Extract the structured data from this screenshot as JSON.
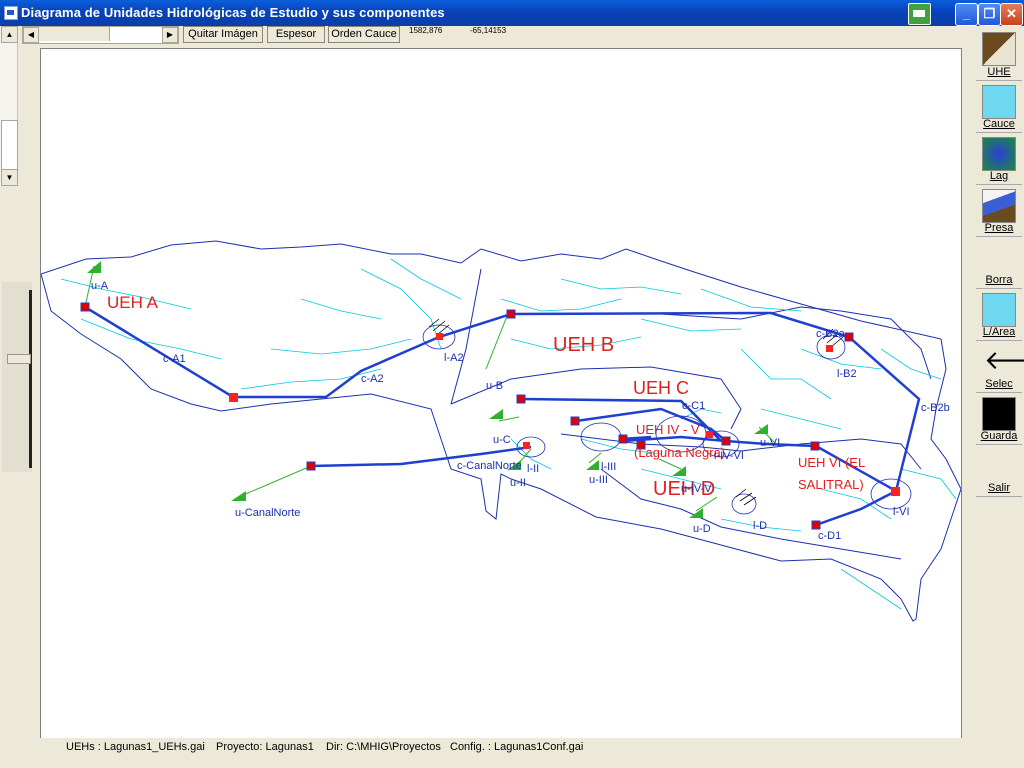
{
  "window": {
    "title": "Diagrama de Unidades Hidrológicas de Estudio y sus componentes"
  },
  "toolbar": {
    "buttons": [
      "Quitar Imágen",
      "Espesor",
      "Orden Cauce"
    ],
    "coord_x": "1582,876",
    "coord_y": "-65,14153"
  },
  "tools": [
    {
      "label": "UHE",
      "icon": "mountain-icon"
    },
    {
      "label": "Cauce",
      "icon": "river-icon"
    },
    {
      "label": "Lag",
      "icon": "lake-icon"
    },
    {
      "label": "Presa",
      "icon": "dam-icon"
    },
    {
      "label": "Borra",
      "icon": ""
    },
    {
      "label": "L/Area",
      "icon": "target-icon"
    },
    {
      "label": "Selec",
      "icon": "arrow-left-icon"
    },
    {
      "label": "Guarda",
      "icon": "floppy-icon"
    },
    {
      "label": "Salir",
      "icon": ""
    }
  ],
  "status": {
    "uehs": "UEHs : Lagunas1_UEHs.gai",
    "project": "Proyecto: Lagunas1",
    "dir": "Dir: C:\\MHIG\\Proyectos",
    "config": "Config. : Lagunas1Conf.gai"
  },
  "map": {
    "regions": [
      "UEH A",
      "UEH B",
      "UEH C",
      "UEH IV - V (Laguna Negra)",
      "UEH D",
      "UEH VI (EL SALITRAL)"
    ],
    "labels": [
      "u-A",
      "c-A1",
      "c-A2",
      "l-A2",
      "u-B",
      "c-B2a",
      "l-B2",
      "c-B2b",
      "c-C1",
      "u-C",
      "c-CanalNorte",
      "l-II",
      "u-II",
      "l-III",
      "u-III",
      "u-CanalNorte",
      "l-IV-VI",
      "u-VI",
      "u-IV-V",
      "u-D",
      "l-D",
      "c-D1",
      "l-VI"
    ]
  },
  "colors": {
    "ueh_text": "#e02020",
    "channel": "#1f3fd0",
    "contour": "#1a2fb0",
    "stream": "#00c8e0",
    "node": "#e00000"
  }
}
